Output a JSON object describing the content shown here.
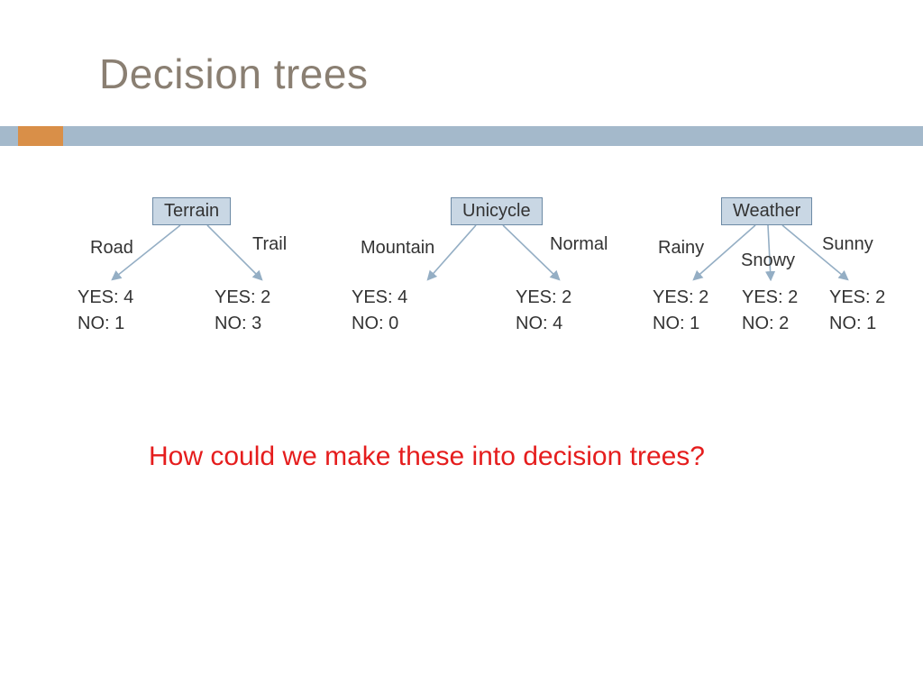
{
  "title": "Decision trees",
  "question": "How could we make these into decision trees?",
  "trees": {
    "terrain": {
      "node": "Terrain",
      "branches": {
        "left": "Road",
        "right": "Trail"
      },
      "leaves": {
        "left": {
          "line1": "YES: 4",
          "line2": "NO: 1"
        },
        "right": {
          "line1": "YES: 2",
          "line2": "NO: 3"
        }
      }
    },
    "unicycle": {
      "node": "Unicycle",
      "branches": {
        "left": "Mountain",
        "right": "Normal"
      },
      "leaves": {
        "left": {
          "line1": "YES: 4",
          "line2": "NO: 0"
        },
        "right": {
          "line1": "YES: 2",
          "line2": "NO: 4"
        }
      }
    },
    "weather": {
      "node": "Weather",
      "branches": {
        "left": "Rainy",
        "mid": "Snowy",
        "right": "Sunny"
      },
      "leaves": {
        "left": {
          "line1": "YES: 2",
          "line2": "NO: 1"
        },
        "mid": {
          "line1": "YES: 2",
          "line2": "NO: 2"
        },
        "right": {
          "line1": "YES: 2",
          "line2": "NO: 1"
        }
      }
    }
  },
  "chart_data": [
    {
      "type": "tree",
      "root": "Terrain",
      "branches": [
        {
          "label": "Road",
          "yes": 4,
          "no": 1
        },
        {
          "label": "Trail",
          "yes": 2,
          "no": 3
        }
      ]
    },
    {
      "type": "tree",
      "root": "Unicycle",
      "branches": [
        {
          "label": "Mountain",
          "yes": 4,
          "no": 0
        },
        {
          "label": "Normal",
          "yes": 2,
          "no": 4
        }
      ]
    },
    {
      "type": "tree",
      "root": "Weather",
      "branches": [
        {
          "label": "Rainy",
          "yes": 2,
          "no": 1
        },
        {
          "label": "Snowy",
          "yes": 2,
          "no": 2
        },
        {
          "label": "Sunny",
          "yes": 2,
          "no": 1
        }
      ]
    }
  ]
}
